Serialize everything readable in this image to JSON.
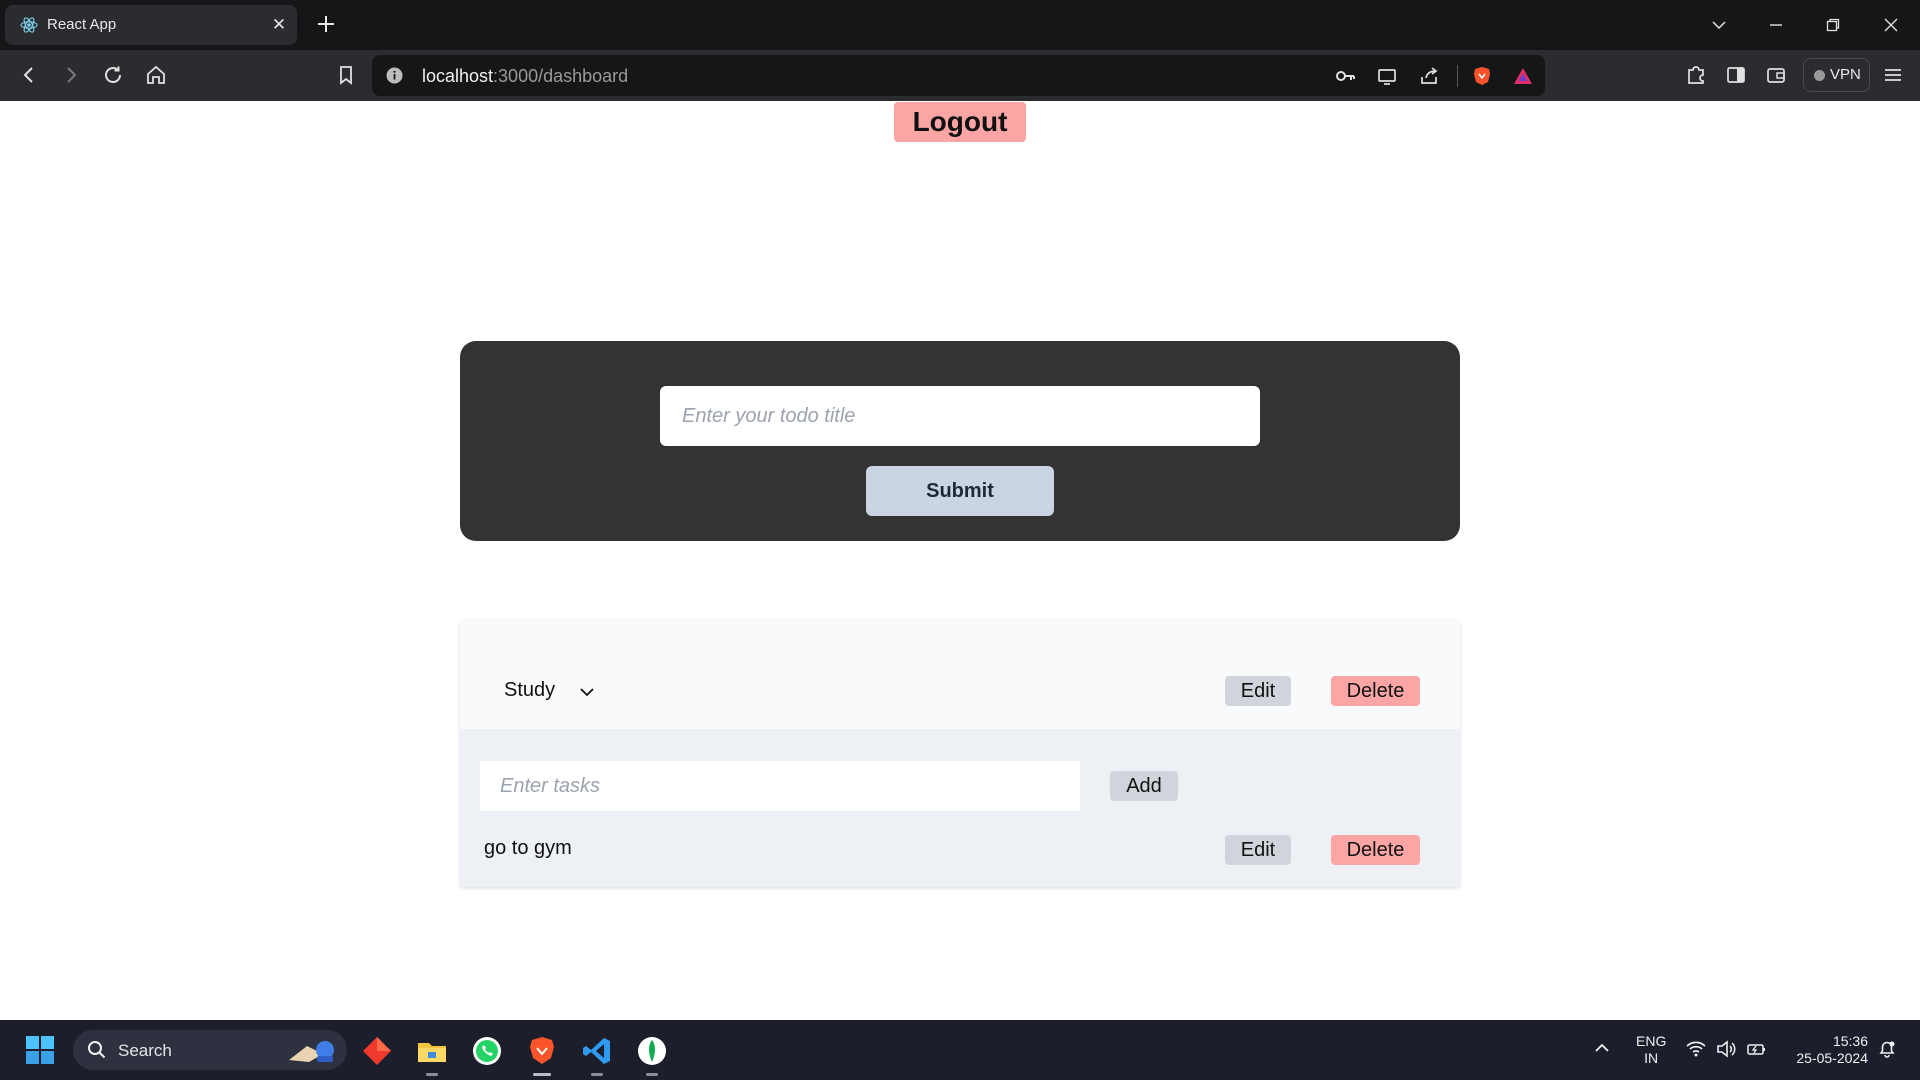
{
  "browser": {
    "tab_title": "React App",
    "url_host": "localhost",
    "url_path": ":3000/dashboard",
    "vpn_label": "VPN"
  },
  "page": {
    "logout_label": "Logout",
    "todo_form": {
      "title_placeholder": "Enter your todo title",
      "title_value": "",
      "submit_label": "Submit"
    },
    "todos": [
      {
        "title": "Study",
        "edit_label": "Edit",
        "delete_label": "Delete",
        "task_placeholder": "Enter tasks",
        "add_label": "Add",
        "tasks": [
          {
            "text": "go to gym",
            "edit_label": "Edit",
            "delete_label": "Delete"
          }
        ]
      }
    ]
  },
  "taskbar": {
    "search_label": "Search",
    "lang_line1": "ENG",
    "lang_line2": "IN",
    "time": "15:36",
    "date": "25-05-2024"
  }
}
